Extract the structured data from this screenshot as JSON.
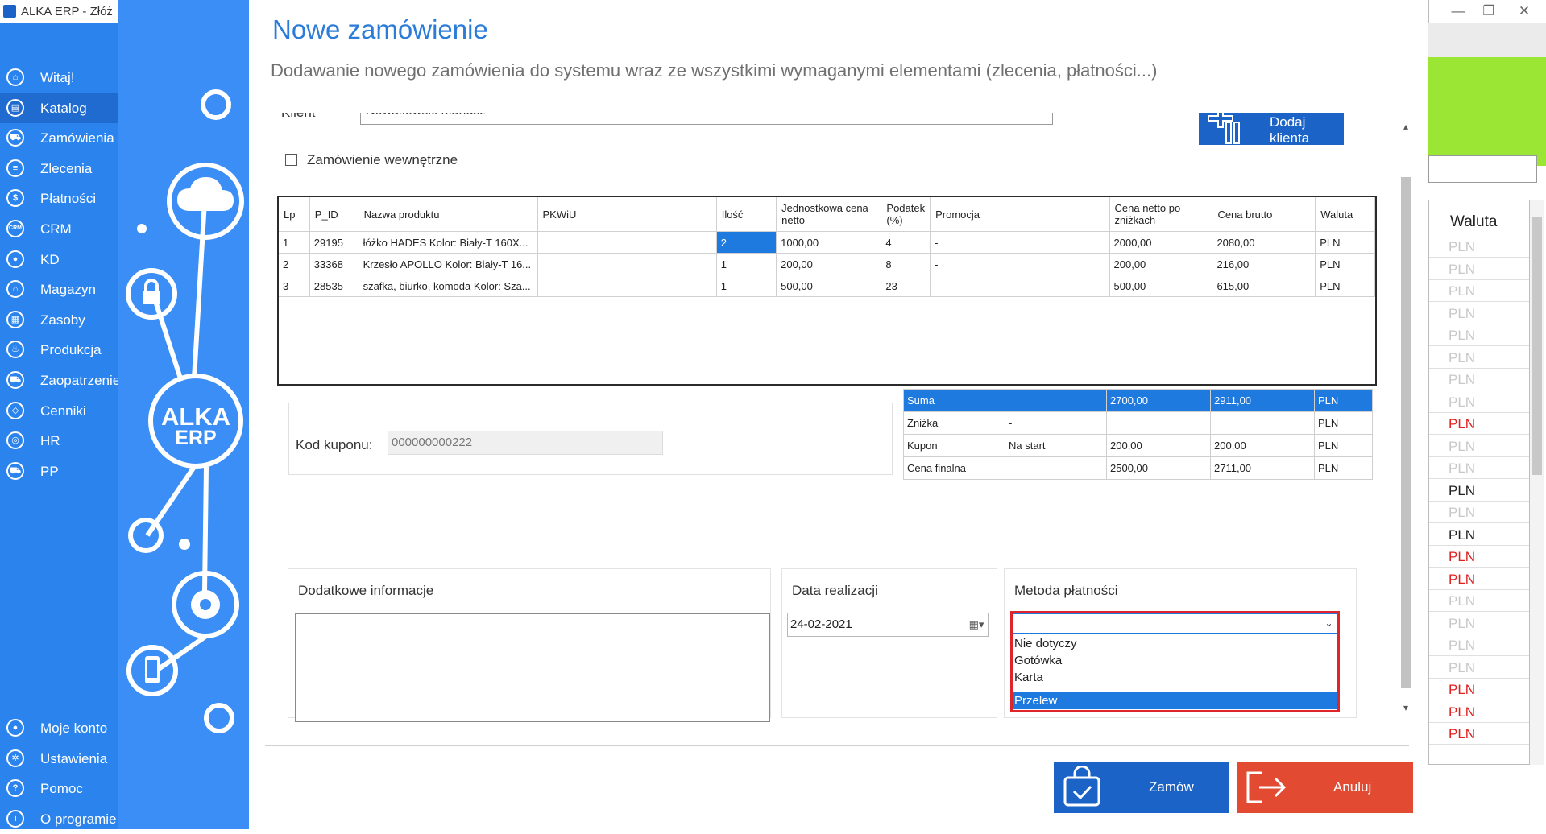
{
  "window": {
    "title": "ALKA ERP - Złóż z",
    "controls": [
      "—",
      "❐",
      "✕"
    ]
  },
  "sidebar": {
    "items": [
      {
        "label": "Witaj!",
        "icon": "home-icon",
        "glyph": "⌂"
      },
      {
        "label": "Katalog",
        "icon": "catalog-icon",
        "glyph": "▤"
      },
      {
        "label": "Zamówienia",
        "icon": "cart-icon",
        "glyph": "⛟"
      },
      {
        "label": "Zlecenia",
        "icon": "list-icon",
        "glyph": "≡"
      },
      {
        "label": "Płatności",
        "icon": "dollar-icon",
        "glyph": "$"
      },
      {
        "label": "CRM",
        "icon": "crm-icon",
        "glyph": "CRM"
      },
      {
        "label": "KD",
        "icon": "person-icon",
        "glyph": "●"
      },
      {
        "label": "Magazyn",
        "icon": "warehouse-icon",
        "glyph": "⌂"
      },
      {
        "label": "Zasoby",
        "icon": "resources-icon",
        "glyph": "▦"
      },
      {
        "label": "Produkcja",
        "icon": "production-icon",
        "glyph": "♨"
      },
      {
        "label": "Zaopatrzenie",
        "icon": "truck-icon",
        "glyph": "⛟"
      },
      {
        "label": "Cenniki",
        "icon": "price-tag-icon",
        "glyph": "◇"
      },
      {
        "label": "HR",
        "icon": "hr-icon",
        "glyph": "◎"
      },
      {
        "label": "PP",
        "icon": "pp-icon",
        "glyph": "⛟"
      }
    ],
    "bottom_items": [
      {
        "label": "Moje konto",
        "icon": "account-icon",
        "glyph": "●"
      },
      {
        "label": "Ustawienia",
        "icon": "settings-icon",
        "glyph": "✲"
      },
      {
        "label": "Pomoc",
        "icon": "help-icon",
        "glyph": "?"
      },
      {
        "label": "O programie",
        "icon": "info-icon",
        "glyph": "i"
      }
    ],
    "active_index": 1,
    "bg_color": "#2b84ee"
  },
  "brand": {
    "logo_line1": "ALKA",
    "logo_line2": "ERP"
  },
  "dialog": {
    "title": "Nowe zamówienie",
    "subtitle": "Dodawanie nowego zamówienia do systemu wraz ze wszystkimi wymaganymi elementami (zlecenia, płatności...)",
    "client_label": "Klient",
    "client_value": "Nowakowski Mariusz",
    "add_client_label": "Dodaj klienta",
    "internal_order_label": "Zamówienie wewnętrzne",
    "internal_order_checked": false
  },
  "products": {
    "columns": [
      "Lp",
      "P_ID",
      "Nazwa produktu",
      "PKWiU",
      "Ilość",
      "Jednostkowa cena netto",
      "Podatek (%)",
      "Promocja",
      "Cena netto po zniżkach",
      "Cena brutto",
      "Waluta"
    ],
    "rows": [
      [
        "1",
        "29195",
        "łóżko HADES Kolor: Biały-T 160X...",
        "",
        "2",
        "1000,00",
        "4",
        "-",
        "2000,00",
        "2080,00",
        "PLN"
      ],
      [
        "2",
        "33368",
        "Krzesło APOLLO Kolor: Biały-T 16...",
        "",
        "1",
        "200,00",
        "8",
        "-",
        "200,00",
        "216,00",
        "PLN"
      ],
      [
        "3",
        "28535",
        "szafka, biurko, komoda Kolor: Sza...",
        "",
        "1",
        "500,00",
        "23",
        "-",
        "500,00",
        "615,00",
        "PLN"
      ]
    ]
  },
  "coupon": {
    "label": "Kod kuponu:",
    "value": "000000000222"
  },
  "summary": {
    "rows": [
      [
        "Suma",
        "",
        "2700,00",
        "2911,00",
        "PLN"
      ],
      [
        "Zniżka",
        "-",
        "",
        "",
        "PLN"
      ],
      [
        "Kupon",
        "Na start",
        "200,00",
        "200,00",
        "PLN"
      ],
      [
        "Cena finalna",
        "",
        "2500,00",
        "2711,00",
        "PLN"
      ]
    ]
  },
  "additional_info": {
    "title": "Dodatkowe informacje",
    "value": ""
  },
  "realization_date": {
    "title": "Data realizacji",
    "value": "24-02-2021"
  },
  "payment": {
    "title": "Metoda płatności",
    "selected_value": "",
    "options": [
      "Nie dotyczy",
      "Gotówka",
      "Karta",
      "Przelew"
    ],
    "highlighted_index": 3,
    "highlight_color": "#e0242b"
  },
  "buttons": {
    "order_label": "Zamów",
    "cancel_label": "Anuluj",
    "order_color": "#1b63c7",
    "cancel_color": "#e24a32"
  },
  "background_window": {
    "column_header": "Waluta",
    "currency_rows": [
      {
        "text": "PLN",
        "color": "#c8c8c8"
      },
      {
        "text": "PLN",
        "color": "#c8c8c8"
      },
      {
        "text": "PLN",
        "color": "#c8c8c8"
      },
      {
        "text": "PLN",
        "color": "#c8c8c8"
      },
      {
        "text": "PLN",
        "color": "#c8c8c8"
      },
      {
        "text": "PLN",
        "color": "#c8c8c8"
      },
      {
        "text": "PLN",
        "color": "#c8c8c8"
      },
      {
        "text": "PLN",
        "color": "#c8c8c8"
      },
      {
        "text": "PLN",
        "color": "#e02020"
      },
      {
        "text": "PLN",
        "color": "#c8c8c8"
      },
      {
        "text": "PLN",
        "color": "#c8c8c8"
      },
      {
        "text": "PLN",
        "color": "#222222"
      },
      {
        "text": "PLN",
        "color": "#c8c8c8"
      },
      {
        "text": "PLN",
        "color": "#222222"
      },
      {
        "text": "PLN",
        "color": "#e02020"
      },
      {
        "text": "PLN",
        "color": "#e02020"
      },
      {
        "text": "PLN",
        "color": "#c8c8c8"
      },
      {
        "text": "PLN",
        "color": "#c8c8c8"
      },
      {
        "text": "PLN",
        "color": "#c8c8c8"
      },
      {
        "text": "PLN",
        "color": "#c8c8c8"
      },
      {
        "text": "PLN",
        "color": "#e02020"
      },
      {
        "text": "PLN",
        "color": "#e02020"
      },
      {
        "text": "PLN",
        "color": "#e02020"
      }
    ]
  }
}
